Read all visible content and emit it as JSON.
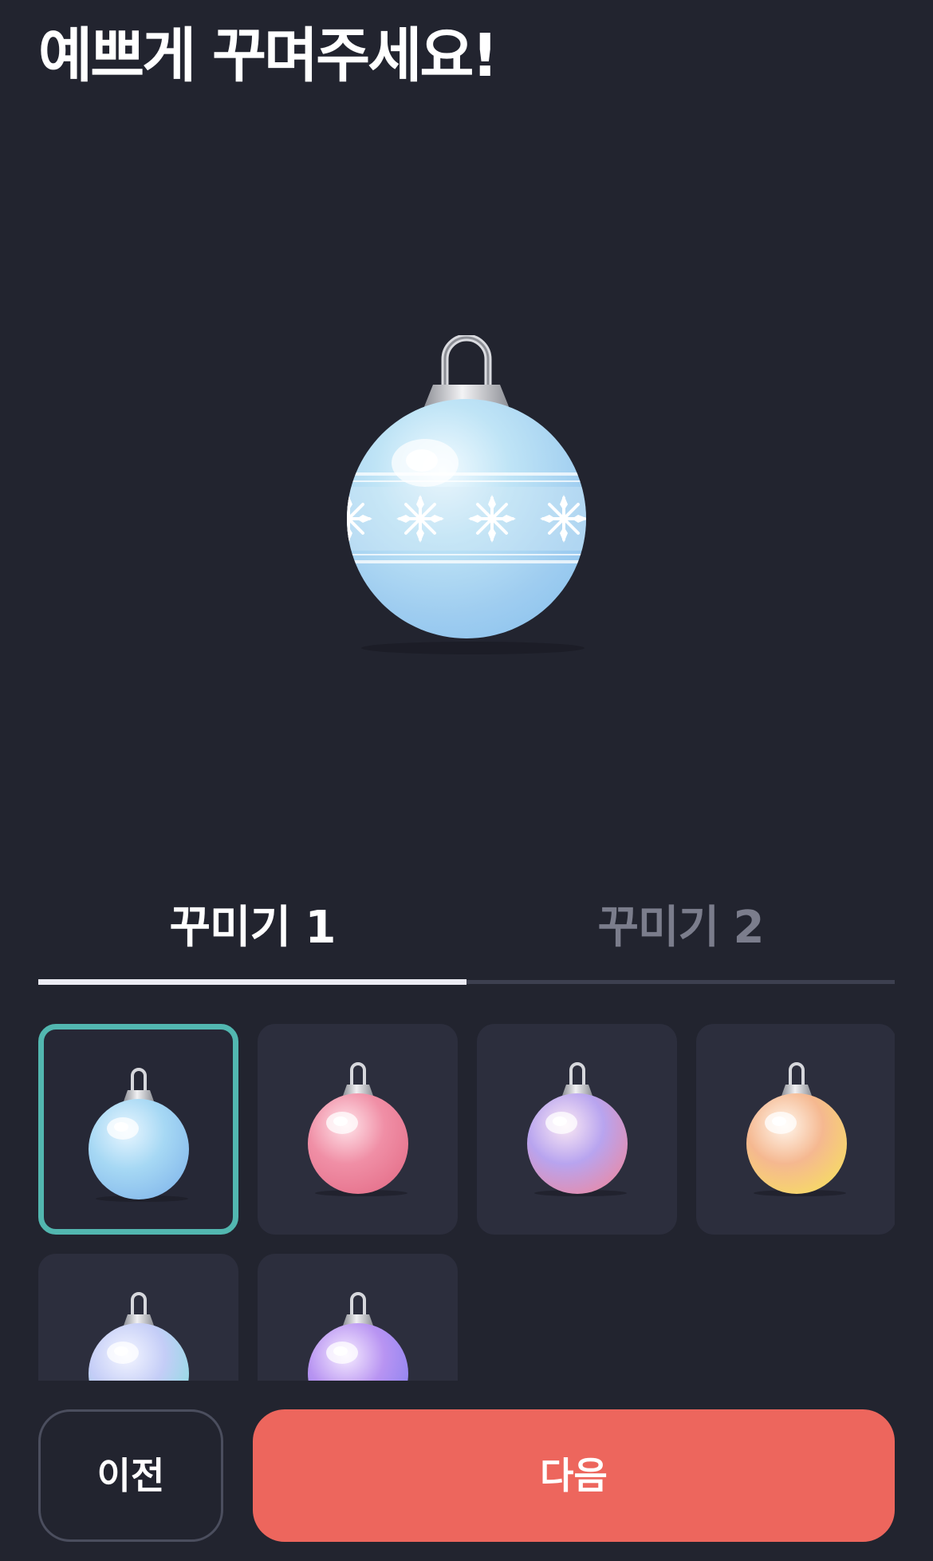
{
  "header": {
    "title": "예쁘게 꾸며주세요!"
  },
  "preview": {
    "ornament": "ornament-blue-snowflake",
    "base_color": "#a9dcf2",
    "pattern": "snowflake-band"
  },
  "tabs": [
    {
      "label": "꾸미기 1",
      "active": true
    },
    {
      "label": "꾸미기 2",
      "active": false
    }
  ],
  "ornaments": [
    {
      "name": "ornament-blue",
      "selected": true,
      "colors": [
        "#e8f6ff",
        "#a6d8f4",
        "#7fb4ea"
      ]
    },
    {
      "name": "ornament-pink",
      "selected": false,
      "colors": [
        "#ffe4ea",
        "#f08fa6",
        "#e36b86"
      ]
    },
    {
      "name": "ornament-pastel-gradient",
      "selected": false,
      "colors": [
        "#fbe9f4",
        "#b8a4ef",
        "#f0869c"
      ]
    },
    {
      "name": "ornament-peach-gold",
      "selected": false,
      "colors": [
        "#fff6ec",
        "#f5b890",
        "#f7e25c"
      ]
    },
    {
      "name": "ornament-mint-lavender",
      "selected": false,
      "colors": [
        "#f4f6ff",
        "#c4cdf7",
        "#7fe1dc"
      ]
    },
    {
      "name": "ornament-purple",
      "selected": false,
      "colors": [
        "#f6ecff",
        "#b894f2",
        "#7f7ef0"
      ]
    }
  ],
  "buttons": {
    "prev_label": "이전",
    "next_label": "다음"
  },
  "colors": {
    "background": "#22242f",
    "cell": "#2c2e3d",
    "selected_border": "#52b7b0",
    "primary": "#ed665d"
  }
}
